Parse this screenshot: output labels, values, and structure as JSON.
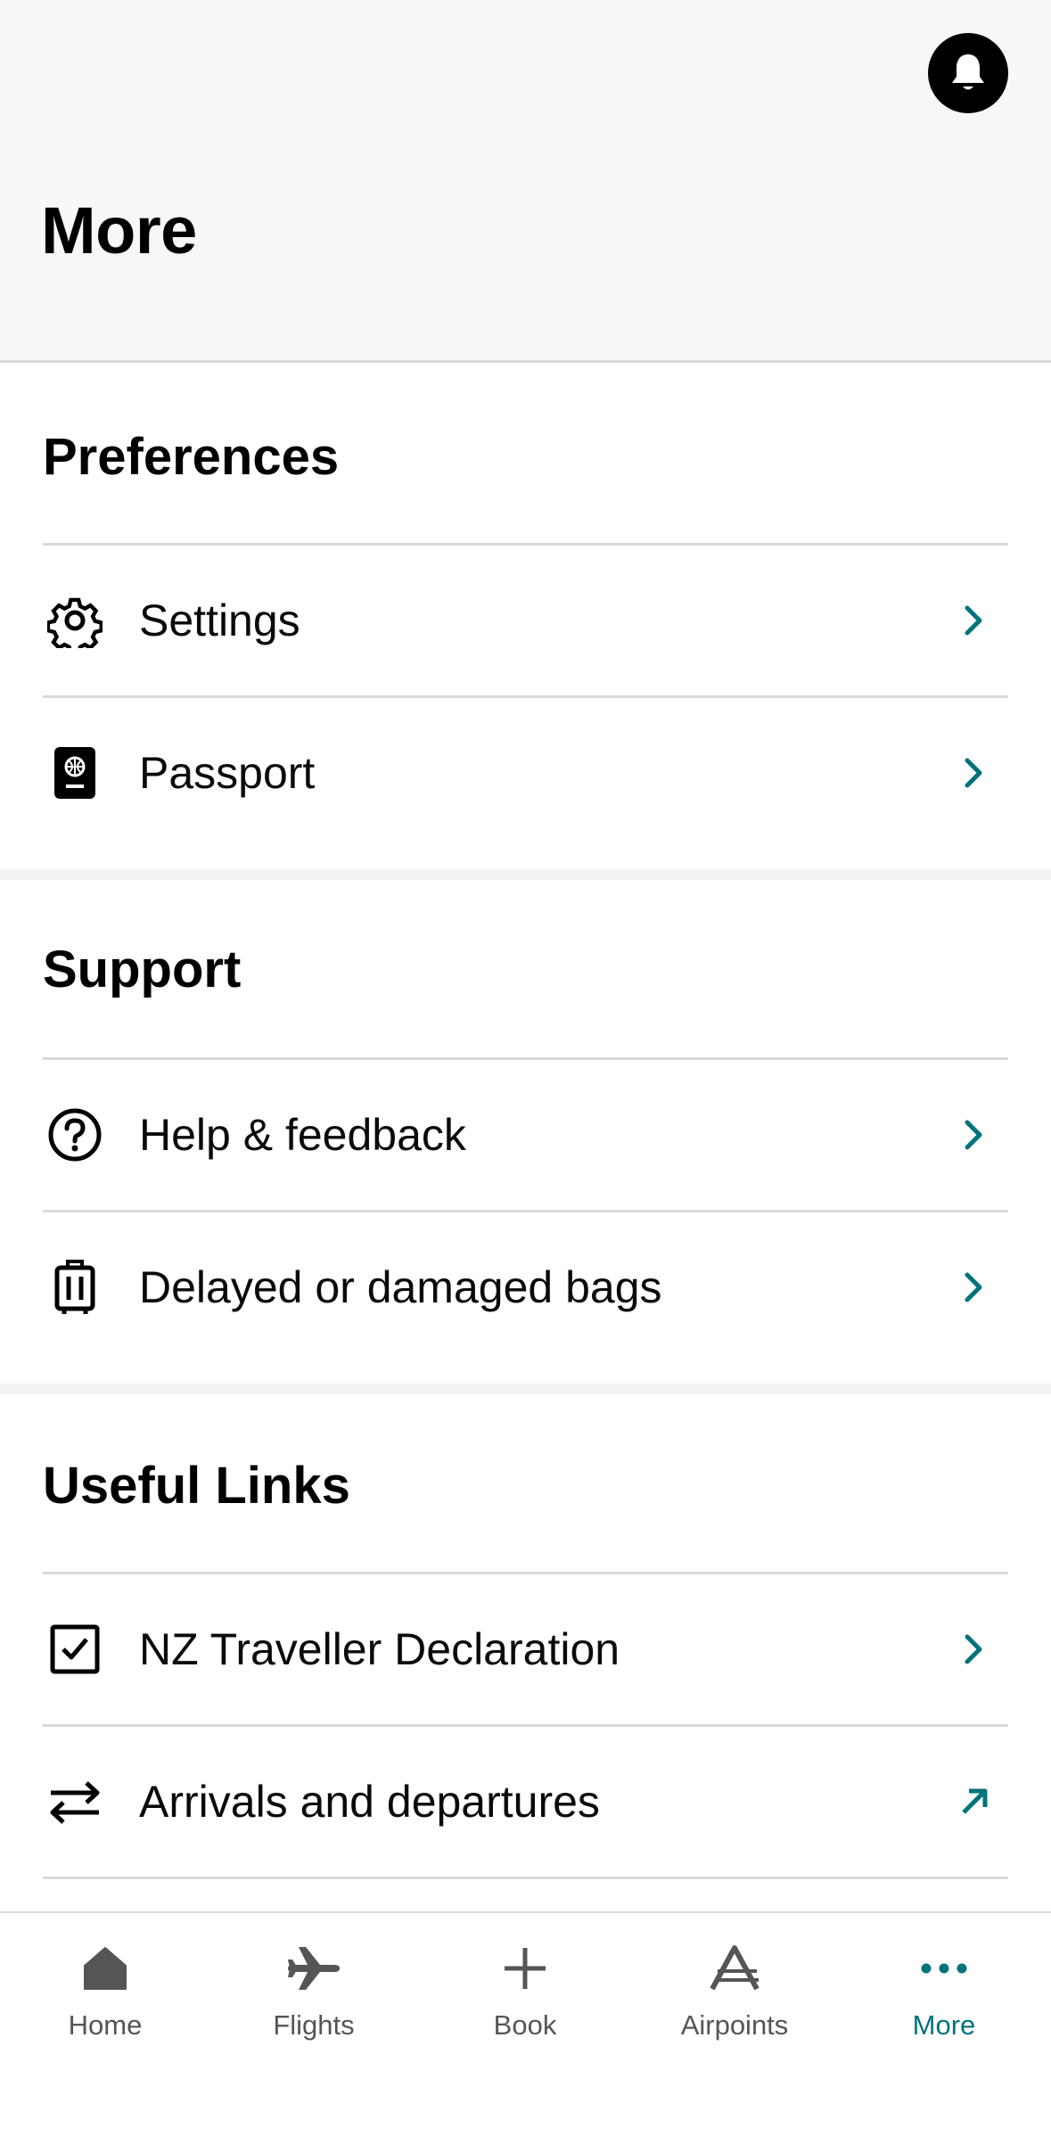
{
  "header": {
    "title": "More"
  },
  "sections": [
    {
      "title": "Preferences",
      "items": [
        {
          "label": "Settings",
          "icon": "gear-icon",
          "action": "chevron-right"
        },
        {
          "label": "Passport",
          "icon": "passport-icon",
          "action": "chevron-right"
        }
      ]
    },
    {
      "title": "Support",
      "items": [
        {
          "label": "Help & feedback",
          "icon": "help-circle-icon",
          "action": "chevron-right"
        },
        {
          "label": "Delayed or damaged bags",
          "icon": "luggage-icon",
          "action": "chevron-right"
        }
      ]
    },
    {
      "title": "Useful Links",
      "items": [
        {
          "label": "NZ Traveller Declaration",
          "icon": "checkbox-icon",
          "action": "chevron-right"
        },
        {
          "label": "Arrivals and departures",
          "icon": "swap-arrows-icon",
          "action": "external-link"
        }
      ]
    }
  ],
  "tabbar": {
    "items": [
      {
        "label": "Home",
        "icon": "home-icon"
      },
      {
        "label": "Flights",
        "icon": "plane-icon"
      },
      {
        "label": "Book",
        "icon": "plus-icon"
      },
      {
        "label": "Airpoints",
        "icon": "airpoints-icon"
      },
      {
        "label": "More",
        "icon": "more-dots-icon",
        "active": true
      }
    ]
  },
  "colors": {
    "accent": "#00737c",
    "inactive_tab": "#555555",
    "header_bg": "#f7f7f7"
  }
}
